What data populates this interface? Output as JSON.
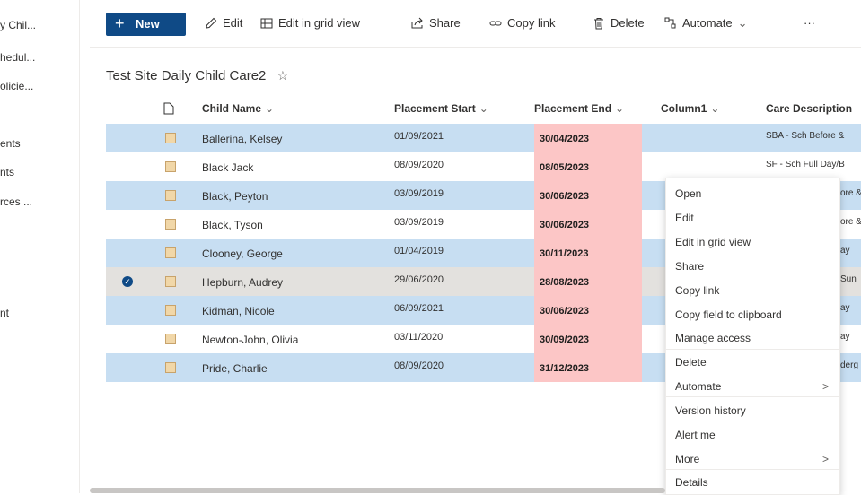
{
  "sidebar": {
    "items": [
      "y Chil...",
      "hedul...",
      "olicie...",
      "ents",
      "nts",
      "rces ...",
      "nt"
    ]
  },
  "toolbar": {
    "new_label": "New",
    "edit_label": "Edit",
    "grid_label": "Edit in grid view",
    "share_label": "Share",
    "copylink_label": "Copy link",
    "delete_label": "Delete",
    "automate_label": "Automate",
    "more_label": "···"
  },
  "list": {
    "title": "Test Site Daily Child Care2",
    "columns": {
      "child_name": "Child Name",
      "placement_start": "Placement Start",
      "placement_end": "Placement End",
      "column1": "Column1",
      "care_description": "Care Description"
    },
    "rows": [
      {
        "name": "Ballerina, Kelsey",
        "start": "01/09/2021",
        "end": "30/04/2023",
        "care": "SBA - Sch Before &"
      },
      {
        "name": "Black Jack",
        "start": "08/09/2020",
        "end": "08/05/2023",
        "care": "SF - Sch Full Day/B"
      },
      {
        "name": "Black, Peyton",
        "start": "03/09/2019",
        "end": "30/06/2023",
        "care": "ore &"
      },
      {
        "name": "Black, Tyson",
        "start": "03/09/2019",
        "end": "30/06/2023",
        "care": "ore &"
      },
      {
        "name": "Clooney, George",
        "start": "01/04/2019",
        "end": "30/11/2023",
        "care": "ay"
      },
      {
        "name": "Hepburn, Audrey",
        "start": "29/06/2020",
        "end": "28/08/2023",
        "care": "Sun"
      },
      {
        "name": "Kidman, Nicole",
        "start": "06/09/2021",
        "end": "30/06/2023",
        "care": "ay"
      },
      {
        "name": "Newton-John, Olivia",
        "start": "03/11/2020",
        "end": "30/09/2023",
        "care": "ay"
      },
      {
        "name": "Pride, Charlie",
        "start": "08/09/2020",
        "end": "31/12/2023",
        "care": "derg"
      }
    ]
  },
  "context_menu": {
    "items": [
      "Open",
      "Edit",
      "Edit in grid view",
      "Share",
      "Copy link",
      "Copy field to clipboard",
      "Manage access",
      "Delete",
      "Automate",
      "Version history",
      "Alert me",
      "More",
      "Details"
    ]
  }
}
